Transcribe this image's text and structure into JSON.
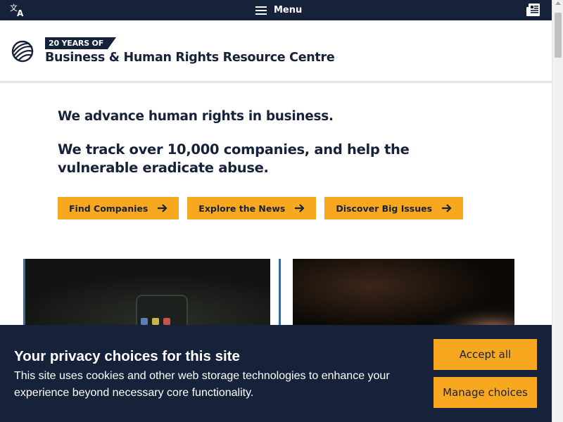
{
  "topbar": {
    "menu_label": "Menu",
    "icons": {
      "translate": "translate-icon",
      "menu": "hamburger-icon",
      "news": "newspaper-icon"
    }
  },
  "header": {
    "badge": "20 YEARS OF",
    "title": "Business & Human Rights Resource Centre",
    "logo": "globe-logo"
  },
  "hero": {
    "line1": "We advance human rights in business.",
    "line2": "We track over 10,000 companies, and help the vulnerable eradicate abuse."
  },
  "buttons": [
    {
      "label": "Find Companies",
      "icon": "arrow-right-icon"
    },
    {
      "label": "Explore the News",
      "icon": "arrow-right-icon"
    },
    {
      "label": "Discover Big Issues",
      "icon": "arrow-right-icon"
    }
  ],
  "cookie_banner": {
    "title": "Your privacy choices for this site",
    "text": "This site uses cookies and other web storage technologies to enhance your experience beyond necessary core functionality.",
    "accept_label": "Accept all",
    "manage_label": "Manage choices"
  },
  "colors": {
    "navy": "#16213a",
    "accent": "#f8a81f",
    "card_border": "#3a6a9c"
  }
}
